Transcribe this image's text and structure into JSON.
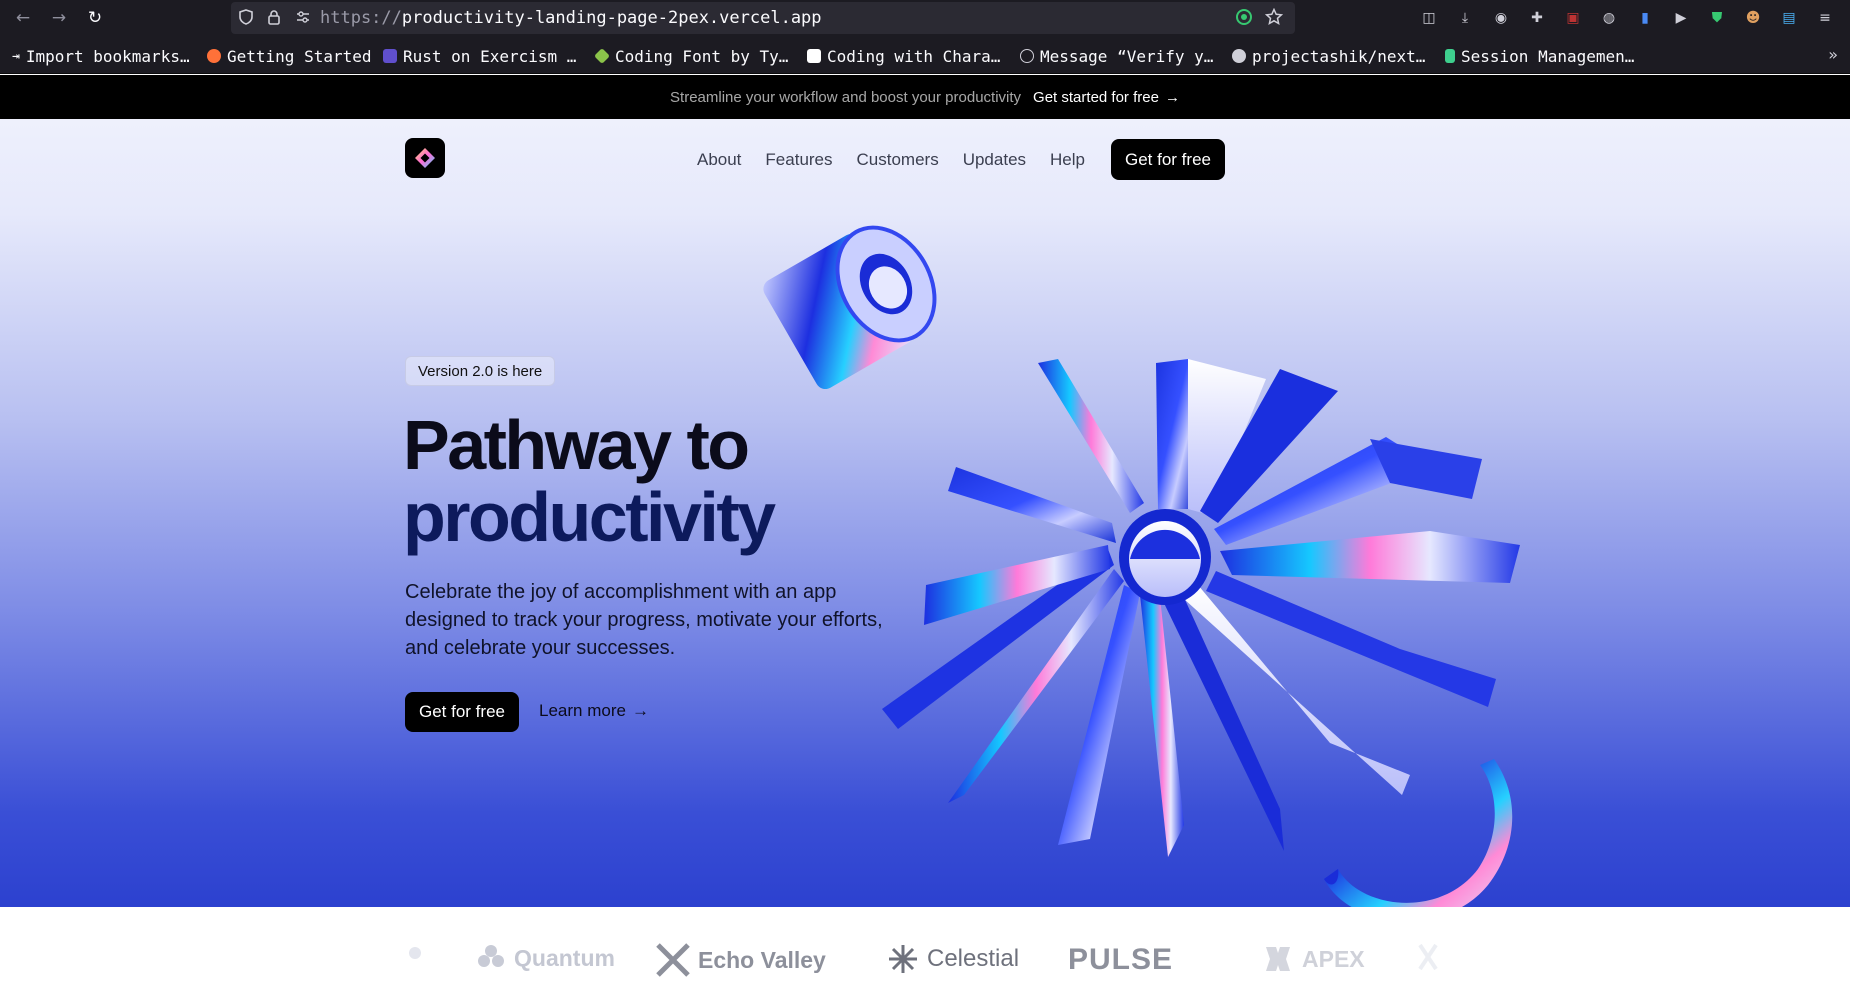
{
  "browser": {
    "url_scheme": "https://",
    "url_host": "productivity-landing-page-2pex.vercel.app",
    "bookmarks": [
      {
        "label": "Import bookmarks…",
        "color": "#fbfbfe"
      },
      {
        "label": "Getting Started",
        "color": "#ff7139"
      },
      {
        "label": "Rust on Exercism …",
        "color": "#604fcd"
      },
      {
        "label": "Coding Font by Ty…",
        "color": "#8bc34a"
      },
      {
        "label": "Coding with Chara…",
        "color": "#ffffff"
      },
      {
        "label": "Message “Verify y…",
        "color": "#cfcfd8"
      },
      {
        "label": "projectashik/next…",
        "color": "#cfcfd8"
      },
      {
        "label": "Session Managemen…",
        "color": "#3ecf8e"
      }
    ]
  },
  "announcement": {
    "text": "Streamline your workflow and boost your productivity",
    "link": "Get started for free",
    "arrow": "→"
  },
  "nav": {
    "items": [
      "About",
      "Features",
      "Customers",
      "Updates",
      "Help"
    ],
    "cta": "Get for free"
  },
  "hero": {
    "badge": "Version 2.0 is here",
    "title_line1": "Pathway to",
    "title_line2": "productivity",
    "subtitle": "Celebrate the joy of accomplishment with an app designed to track your progress, motivate your efforts, and celebrate your successes.",
    "primary_cta": "Get for free",
    "secondary_cta": "Learn more",
    "secondary_arrow": "→"
  },
  "logos": [
    "Quantum",
    "Echo Valley",
    "Celestial",
    "PULSE",
    "APEX"
  ],
  "colors": {
    "accent": "#2c41cf",
    "cta_bg": "#000000",
    "headline": "#0b0b1a",
    "headline_line2": "#0d1a5c"
  }
}
